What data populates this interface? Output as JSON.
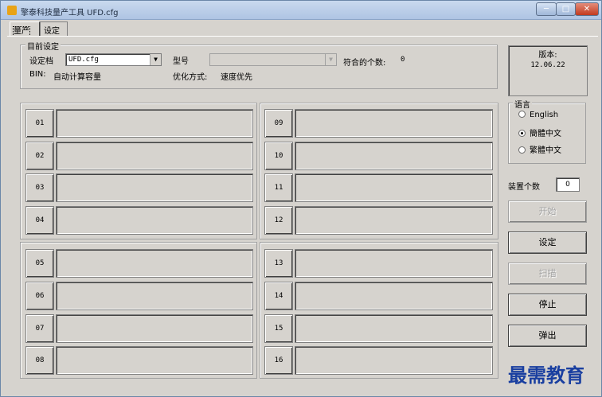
{
  "window": {
    "title": "擎泰科技量产工具 UFD.cfg",
    "caption_min": "─",
    "caption_max": "□",
    "caption_close": "✕"
  },
  "tabs": [
    {
      "label": "量产",
      "active": true
    },
    {
      "label": "设定",
      "active": false
    }
  ],
  "current_settings": {
    "group_title": "目前设定",
    "config_label": "设定档",
    "config_value": "UFD.cfg",
    "model_label": "型号",
    "model_value": "",
    "match_count_label": "符合的个数:",
    "match_count_value": "0",
    "bin_label": "BIN:",
    "bin_value": "自动计算容量",
    "optimize_label": "优化方式:",
    "optimize_value": "速度优先"
  },
  "slots": [
    {
      "number": "01"
    },
    {
      "number": "02"
    },
    {
      "number": "03"
    },
    {
      "number": "04"
    },
    {
      "number": "05"
    },
    {
      "number": "06"
    },
    {
      "number": "07"
    },
    {
      "number": "08"
    },
    {
      "number": "09"
    },
    {
      "number": "10"
    },
    {
      "number": "11"
    },
    {
      "number": "12"
    },
    {
      "number": "13"
    },
    {
      "number": "14"
    },
    {
      "number": "15"
    },
    {
      "number": "16"
    }
  ],
  "version": {
    "label": "版本:",
    "value": "12.06.22"
  },
  "language": {
    "group_title": "语言",
    "options": [
      {
        "label": "English",
        "checked": false
      },
      {
        "label": "簡體中文",
        "checked": true
      },
      {
        "label": "繁體中文",
        "checked": false
      }
    ]
  },
  "device_count": {
    "label": "装置个数",
    "value": "0"
  },
  "buttons": {
    "start": {
      "label": "开始",
      "enabled": false
    },
    "settings": {
      "label": "设定",
      "enabled": true
    },
    "scan": {
      "label": "扫描",
      "enabled": false
    },
    "stop": {
      "label": "停止",
      "enabled": true
    },
    "eject": {
      "label": "弹出",
      "enabled": true
    }
  },
  "watermark": {
    "text": "最需教育"
  },
  "colors": {
    "window_bg": "#d6d3ce",
    "titlebar": "#aec4e3",
    "watermark": "#1a3fa0"
  }
}
